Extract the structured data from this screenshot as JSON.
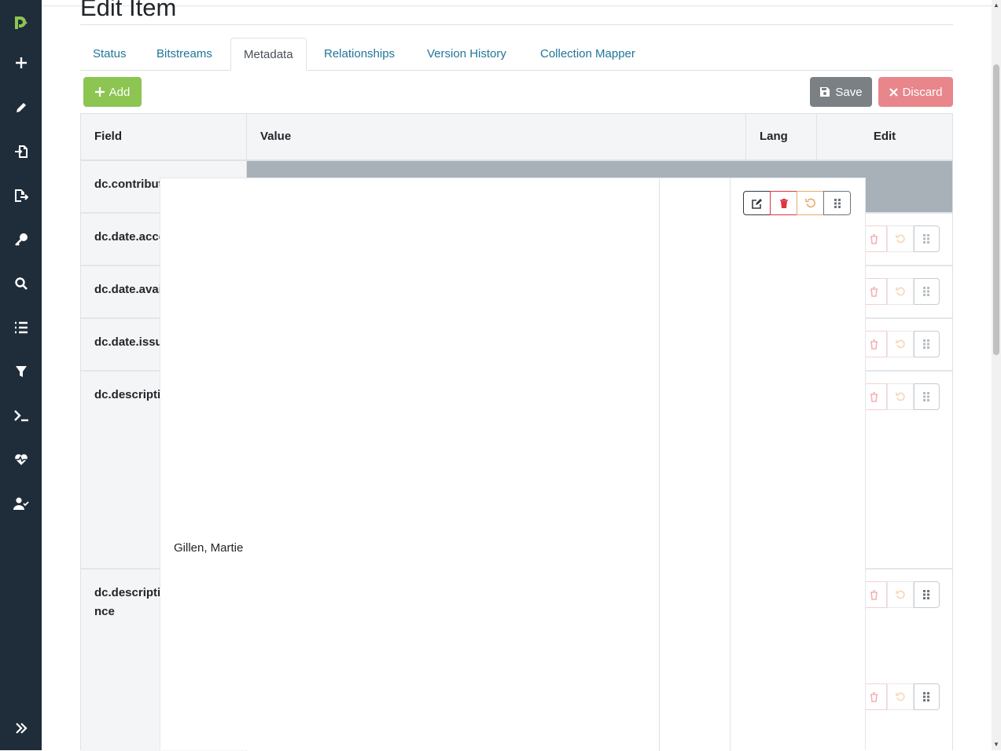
{
  "sidebar": {
    "items": [
      {
        "icon": "dspace-logo-icon"
      },
      {
        "icon": "plus-icon"
      },
      {
        "icon": "pencil-icon"
      },
      {
        "icon": "import-icon"
      },
      {
        "icon": "export-icon"
      },
      {
        "icon": "key-icon"
      },
      {
        "icon": "search-icon"
      },
      {
        "icon": "list-icon"
      },
      {
        "icon": "filter-icon"
      },
      {
        "icon": "terminal-icon"
      },
      {
        "icon": "heartbeat-icon"
      },
      {
        "icon": "user-check-icon"
      },
      {
        "icon": "expand-icon"
      }
    ]
  },
  "page": {
    "title": "Edit Item"
  },
  "tabs": [
    {
      "label": "Status"
    },
    {
      "label": "Bitstreams"
    },
    {
      "label": "Metadata",
      "active": true
    },
    {
      "label": "Relationships"
    },
    {
      "label": "Version History"
    },
    {
      "label": "Collection Mapper"
    }
  ],
  "toolbar": {
    "add_label": "Add",
    "save_label": "Save",
    "discard_label": "Discard"
  },
  "table": {
    "headers": {
      "field": "Field",
      "value": "Value",
      "lang": "Lang",
      "edit": "Edit"
    },
    "rows": [
      {
        "field": "dc.contributor"
      },
      {
        "field": "dc.date.accessioned"
      },
      {
        "field": "dc.date.available"
      },
      {
        "field": "dc.date.issued"
      },
      {
        "field": "dc.description"
      },
      {
        "field": "dc.descriptio",
        "field_line2": "nce"
      }
    ]
  },
  "drag_preview": {
    "value": "Gillen, Martie"
  },
  "colors": {
    "sidebar": "#1f2d3a",
    "brand_green": "#8cc552",
    "link": "#207698",
    "save": "#7b8085",
    "discard": "#e8868c",
    "danger": "#dc3545",
    "warning": "#e9ab6b"
  }
}
